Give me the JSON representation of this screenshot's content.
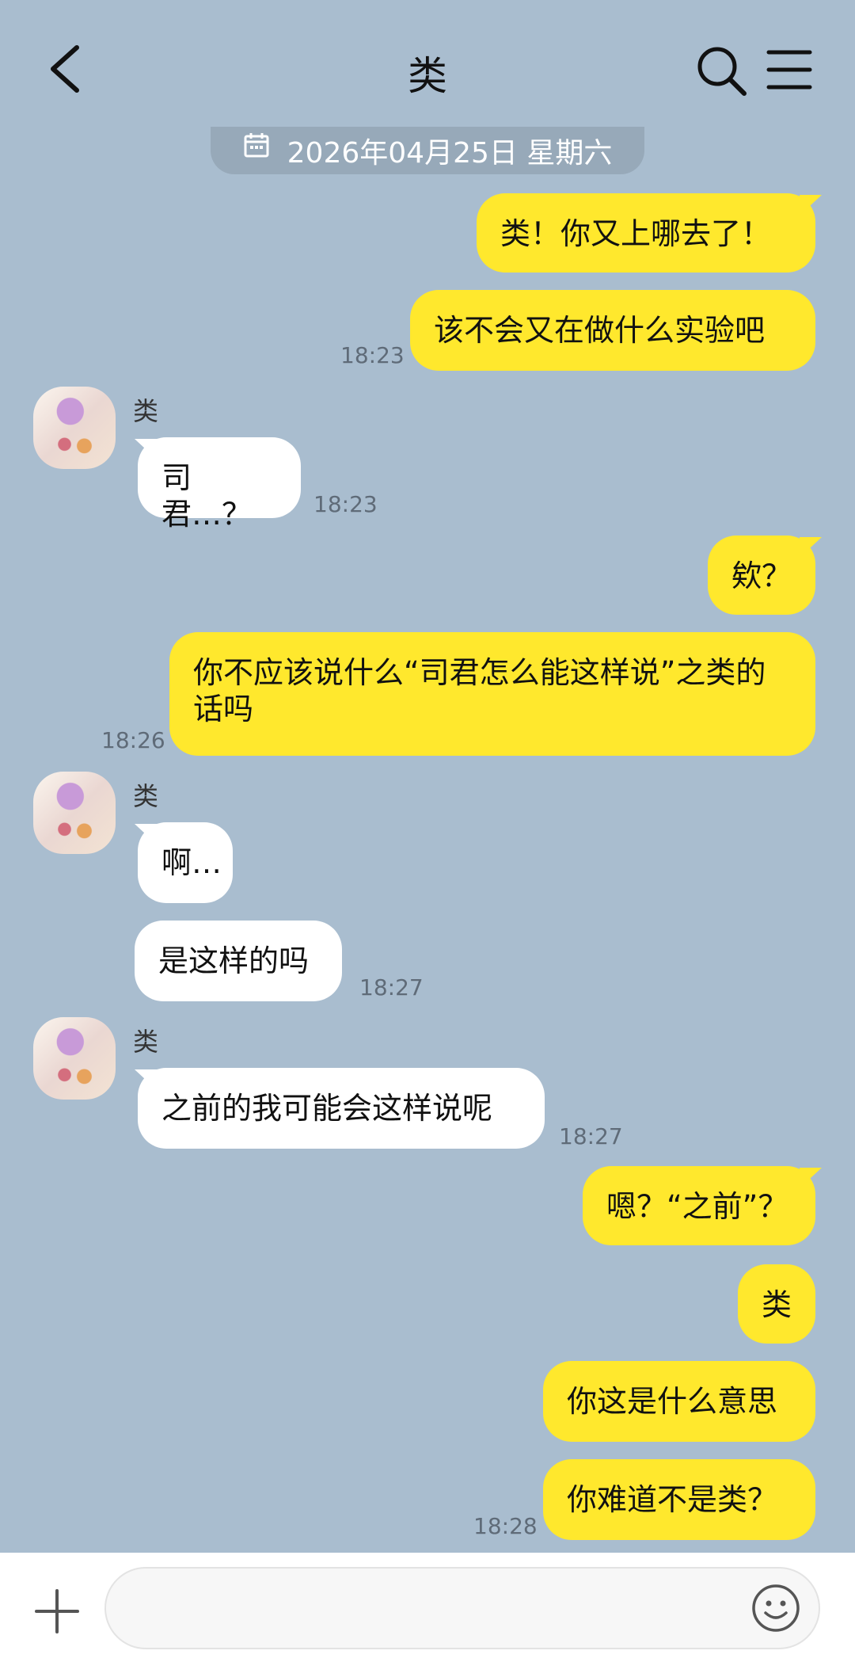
{
  "header": {
    "title": "类",
    "back_icon": "chevron-left-icon",
    "search_icon": "search-icon",
    "menu_icon": "hamburger-menu-icon"
  },
  "date_divider": {
    "text": "2026年04月25日 星期六",
    "icon": "calendar-icon"
  },
  "messages": [
    {
      "dir": "out",
      "text": "类！你又上哪去了！"
    },
    {
      "dir": "out",
      "text": "该不会又在做什么实验吧",
      "time": "18:23"
    },
    {
      "dir": "in",
      "sender": "类",
      "text": "司君…？",
      "time": "18:23"
    },
    {
      "dir": "out",
      "text": "欸？"
    },
    {
      "dir": "out",
      "text": "你不应该说什么“司君怎么能这样说”之类的话吗",
      "time": "18:26"
    },
    {
      "dir": "in",
      "sender": "类",
      "text": "啊…"
    },
    {
      "dir": "in",
      "text": "是这样的吗",
      "time": "18:27"
    },
    {
      "dir": "in",
      "sender": "类",
      "text": "之前的我可能会这样说呢",
      "time": "18:27"
    },
    {
      "dir": "out",
      "text": "嗯？“之前”？"
    },
    {
      "dir": "out",
      "text": "类"
    },
    {
      "dir": "out",
      "text": "你这是什么意思"
    },
    {
      "dir": "out",
      "text": "你难道不是类？",
      "time": "18:28"
    }
  ],
  "input_bar": {
    "plus_icon": "plus-icon",
    "message_input_value": "",
    "emoji_icon": "emoji-icon"
  },
  "colors": {
    "background": "#a9bdcf",
    "outgoing_bubble": "#ffe82d",
    "incoming_bubble": "#ffffff",
    "timestamp": "#5f6b78"
  }
}
